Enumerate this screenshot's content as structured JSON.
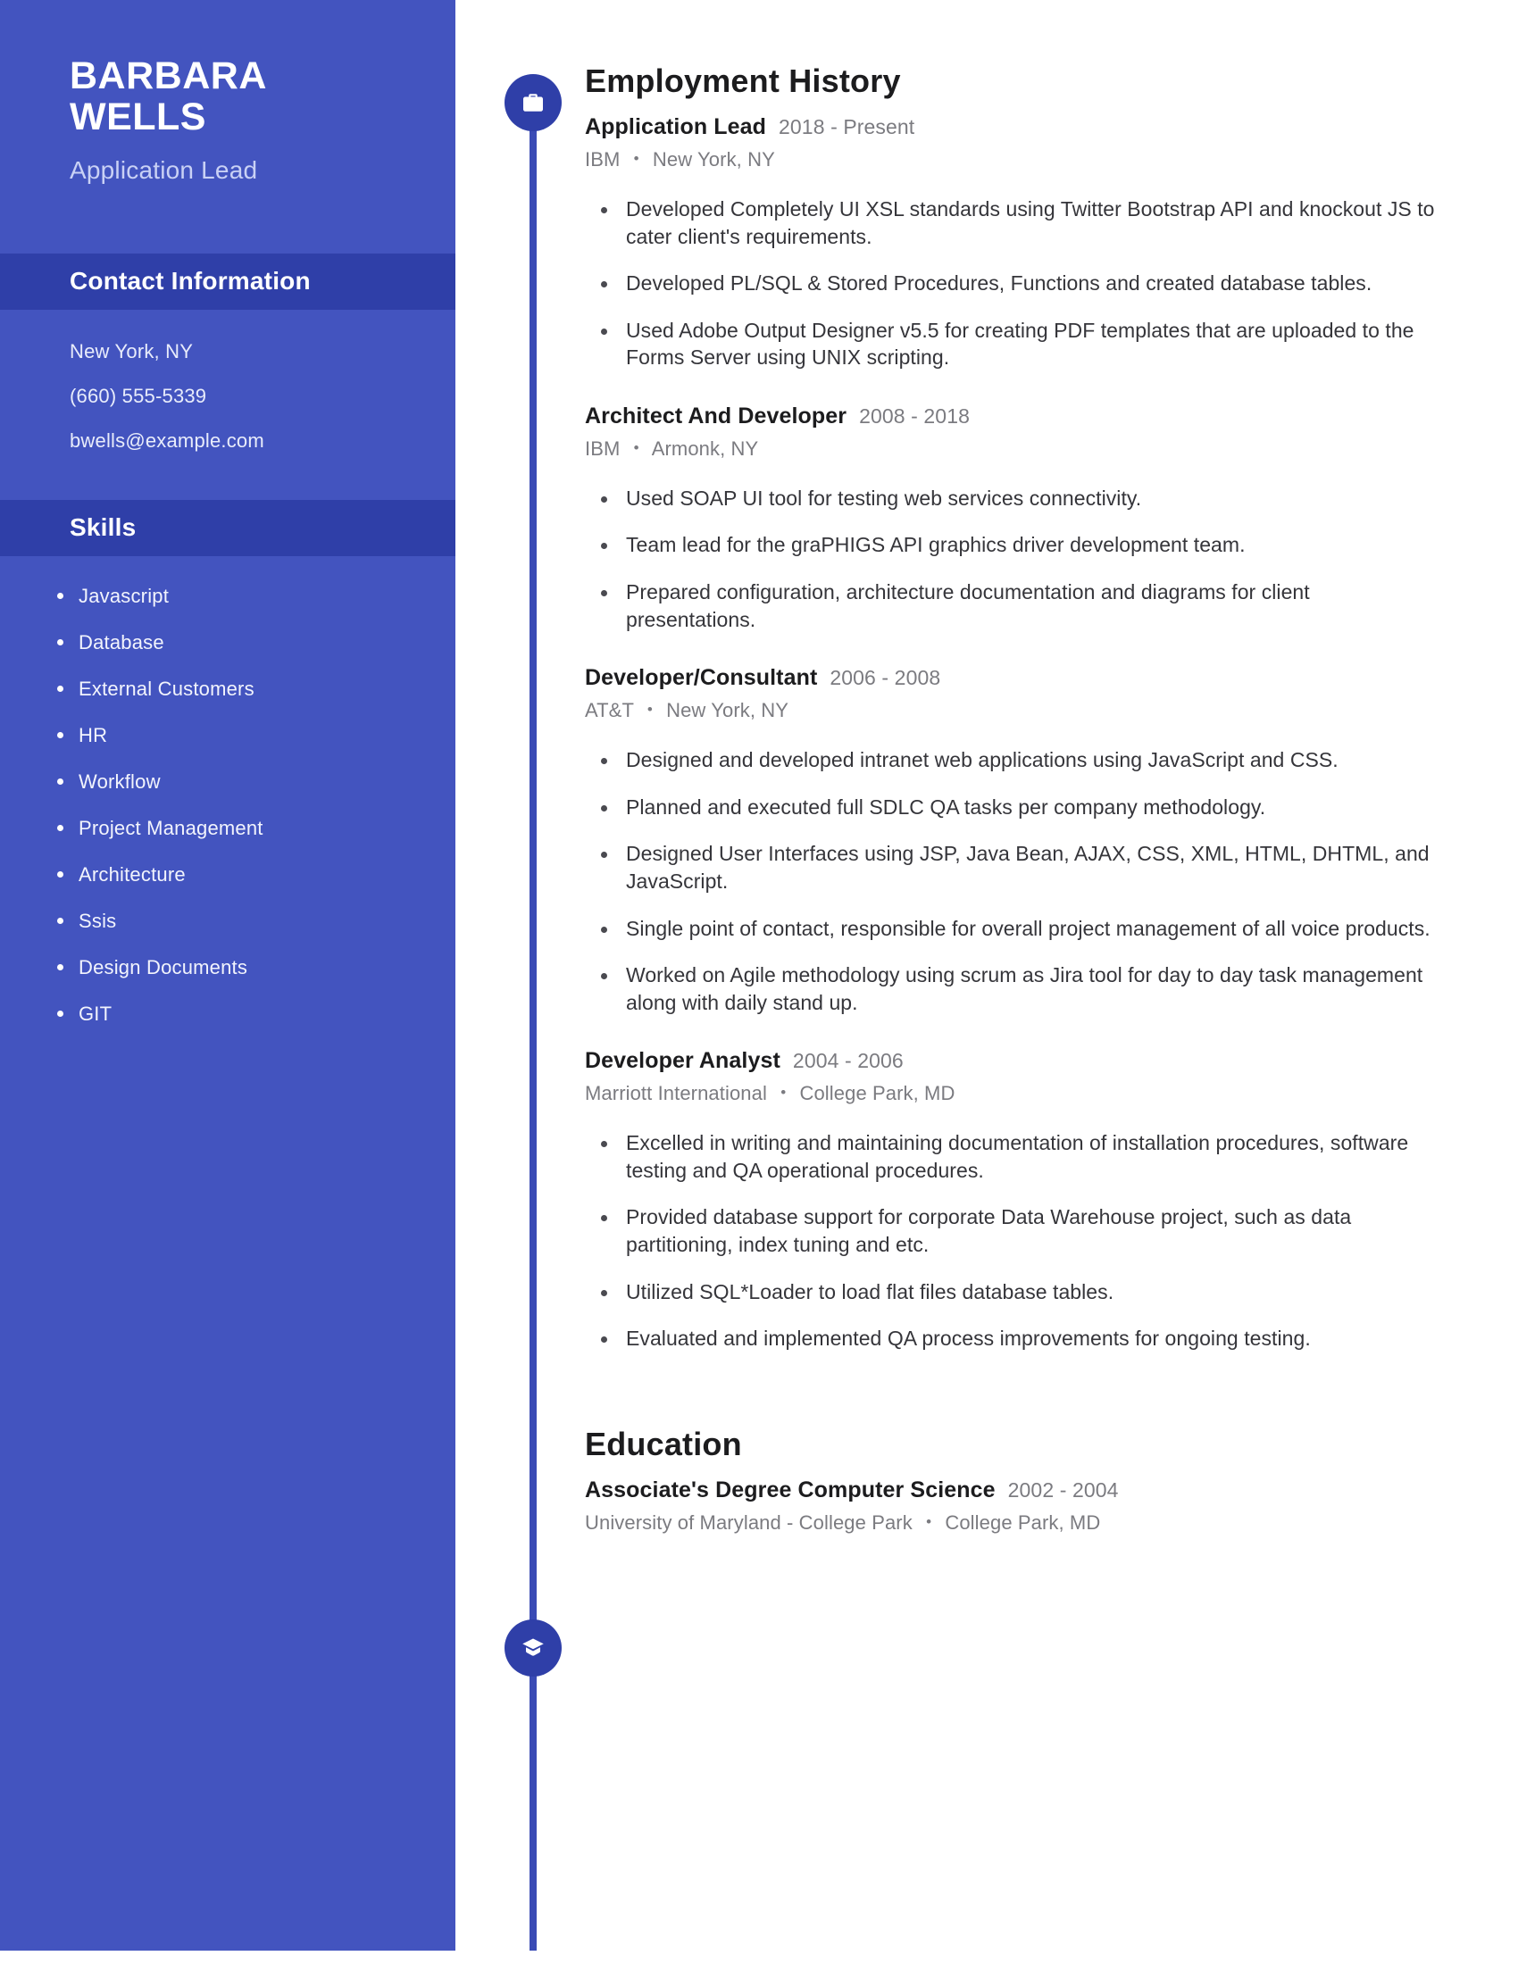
{
  "sidebar": {
    "first_name": "BARBARA",
    "last_name": "WELLS",
    "job_title": "Application Lead",
    "contact_heading": "Contact Information",
    "contact": [
      "New York, NY",
      "(660) 555-5339",
      "bwells@example.com"
    ],
    "skills_heading": "Skills",
    "skills": [
      "Javascript",
      "Database",
      "External Customers",
      "HR",
      "Workflow",
      "Project Management",
      "Architecture",
      "Ssis",
      "Design Documents",
      "GIT"
    ],
    "background_color": "#4354bf",
    "band_color": "#2f3fa8"
  },
  "employment": {
    "heading": "Employment History",
    "icon": "briefcase-icon",
    "jobs": [
      {
        "title": "Application Lead",
        "dates": "2018 - Present",
        "company": "IBM",
        "location": "New York, NY",
        "bullets": [
          "Developed Completely UI XSL standards using Twitter Bootstrap API and knockout JS to cater client's requirements.",
          "Developed PL/SQL & Stored Procedures, Functions and created database tables.",
          "Used Adobe Output Designer v5.5 for creating PDF templates that are uploaded to the Forms Server using UNIX scripting."
        ]
      },
      {
        "title": "Architect And Developer",
        "dates": "2008 - 2018",
        "company": "IBM",
        "location": "Armonk, NY",
        "bullets": [
          "Used SOAP UI tool for testing web services connectivity.",
          "Team lead for the graPHIGS API graphics driver development team.",
          "Prepared configuration, architecture documentation and diagrams for client presentations."
        ]
      },
      {
        "title": "Developer/Consultant",
        "dates": "2006 - 2008",
        "company": "AT&T",
        "location": "New York, NY",
        "bullets": [
          "Designed and developed intranet web applications using JavaScript and CSS.",
          "Planned and executed full SDLC QA tasks per company methodology.",
          "Designed User Interfaces using JSP, Java Bean, AJAX, CSS, XML, HTML, DHTML, and JavaScript.",
          "Single point of contact, responsible for overall project management of all voice products.",
          "Worked on Agile methodology using scrum as Jira tool for day to day task management along with daily stand up."
        ]
      },
      {
        "title": "Developer Analyst",
        "dates": "2004 - 2006",
        "company": "Marriott International",
        "location": "College Park, MD",
        "bullets": [
          "Excelled in writing and maintaining documentation of installation procedures, software testing and QA operational procedures.",
          "Provided database support for corporate Data Warehouse project, such as data partitioning, index tuning and etc.",
          "Utilized SQL*Loader to load flat files database tables.",
          "Evaluated and implemented QA process improvements for ongoing testing."
        ]
      }
    ]
  },
  "education": {
    "heading": "Education",
    "icon": "graduation-cap-icon",
    "entries": [
      {
        "degree": "Associate's Degree Computer Science",
        "dates": "2002 - 2004",
        "school": "University of Maryland - College Park",
        "location": "College Park, MD"
      }
    ]
  },
  "separator": "•"
}
